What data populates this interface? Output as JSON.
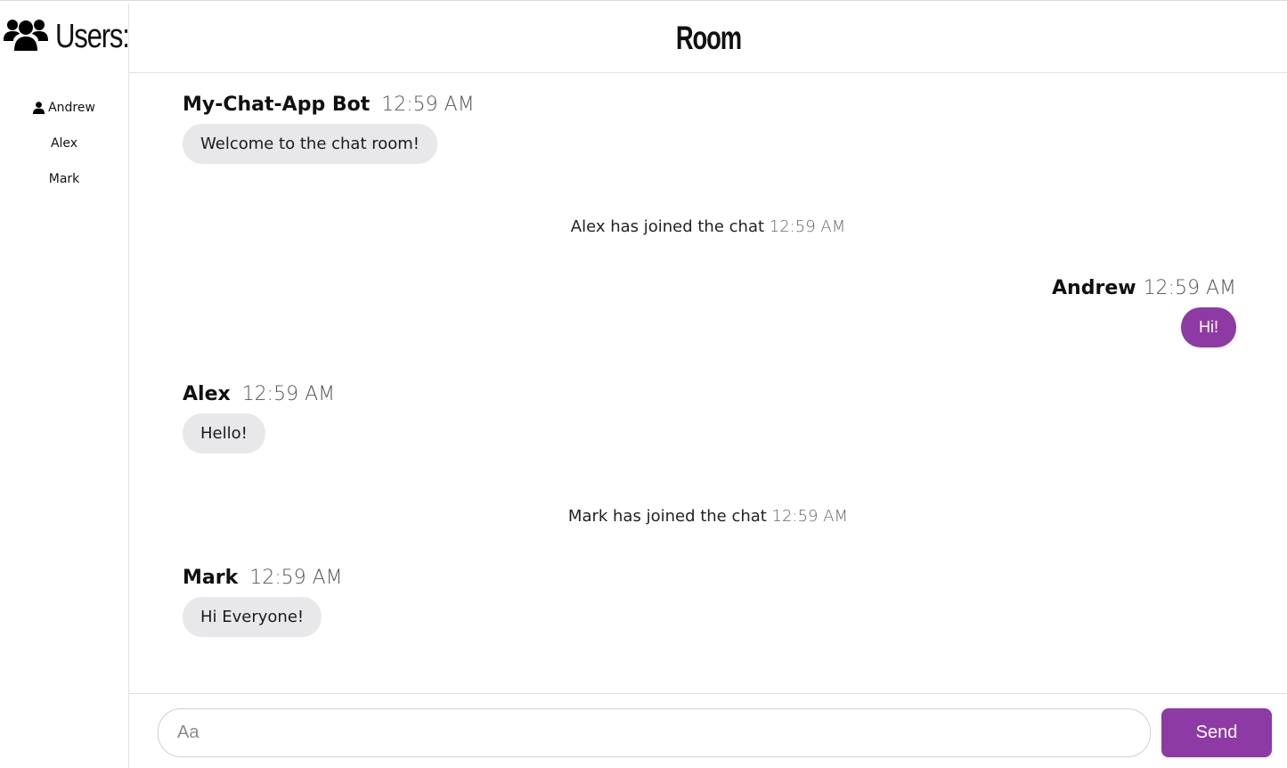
{
  "sidebar": {
    "title": "Users:",
    "icon": "users-group-icon",
    "users": [
      {
        "name": "Andrew",
        "is_self": true
      },
      {
        "name": "Alex"
      },
      {
        "name": "Mark"
      }
    ]
  },
  "header": {
    "title": "Room"
  },
  "messages": [
    {
      "type": "message",
      "author": "My-Chat-App Bot",
      "time": "12:59 AM",
      "text": "Welcome to the chat room!",
      "side": "left"
    },
    {
      "type": "system",
      "text": "Alex has joined the chat",
      "time": "12:59 AM"
    },
    {
      "type": "message",
      "author": "Andrew",
      "time": "12:59 AM",
      "text": "Hi!",
      "side": "right"
    },
    {
      "type": "message",
      "author": "Alex",
      "time": "12:59 AM",
      "text": "Hello!",
      "side": "left"
    },
    {
      "type": "system",
      "text": "Mark has joined the chat",
      "time": "12:59 AM"
    },
    {
      "type": "message",
      "author": "Mark",
      "time": "12:59 AM",
      "text": "Hi Everyone!",
      "side": "left"
    }
  ],
  "composer": {
    "placeholder": "Aa",
    "value": "",
    "send_label": "Send"
  },
  "colors": {
    "accent": "#8e3aa5",
    "bubble": "#e8e7ea"
  }
}
